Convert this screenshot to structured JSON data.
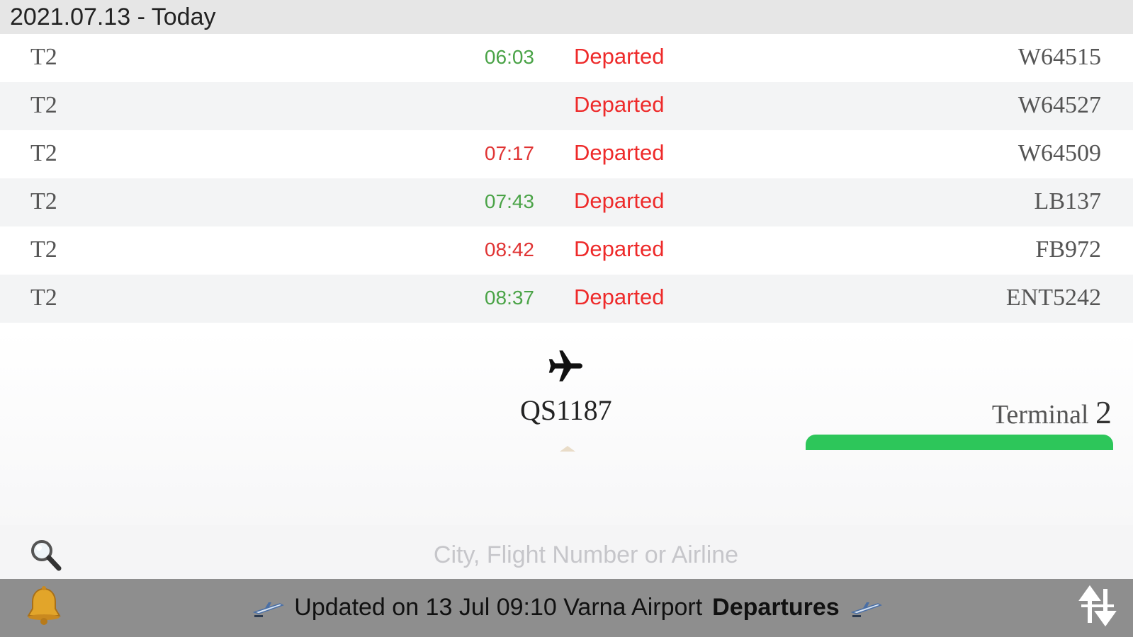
{
  "section_header": {
    "title": "2021.07.13 - Today"
  },
  "rows": [
    {
      "terminal": "T2",
      "time": "06:03",
      "time_color": "green",
      "status": "Departed",
      "flight": "W64515"
    },
    {
      "terminal": "T2",
      "time": "",
      "time_color": "green",
      "status": "Departed",
      "flight": "W64527"
    },
    {
      "terminal": "T2",
      "time": "07:17",
      "time_color": "red",
      "status": "Departed",
      "flight": "W64509"
    },
    {
      "terminal": "T2",
      "time": "07:43",
      "time_color": "green",
      "status": "Departed",
      "flight": "LB137"
    },
    {
      "terminal": "T2",
      "time": "08:42",
      "time_color": "red",
      "status": "Departed",
      "flight": "FB972"
    },
    {
      "terminal": "T2",
      "time": "08:37",
      "time_color": "green",
      "status": "Departed",
      "flight": "ENT5242"
    }
  ],
  "detail": {
    "flight": "QS1187",
    "terminal_word": "Terminal",
    "terminal_number": "2",
    "icon": "airplane-icon"
  },
  "search": {
    "placeholder": "City, Flight Number or Airline",
    "value": ""
  },
  "footer": {
    "updated_text": "Updated on 13 Jul 09:10 Varna Airport",
    "mode": "Departures",
    "left_icon": "bell-icon",
    "right_icon": "arrivals-departures-switch-icon"
  },
  "colors": {
    "status_red": "#ee2a2a",
    "time_green": "#4aa347",
    "time_red": "#e03434",
    "terminal_bar": "#2dc65a",
    "footer_bg": "#8e8e8e"
  }
}
